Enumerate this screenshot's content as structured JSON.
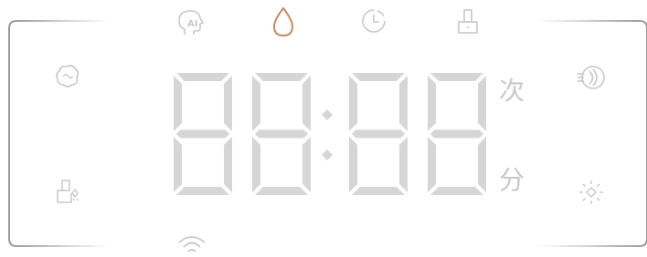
{
  "colors": {
    "inactive": "#c8c8c8",
    "segment": "#d6d6d6",
    "active_accent": "#c98a5c",
    "frame": "#9a9a9a"
  },
  "top_icons": [
    {
      "name": "ai-head-icon",
      "label": "AI",
      "active": false
    },
    {
      "name": "water-drop-icon",
      "active": true
    },
    {
      "name": "clock-timer-icon",
      "active": false
    },
    {
      "name": "faucet-icon",
      "active": false
    }
  ],
  "left_icons": [
    {
      "name": "stain-icon",
      "active": false
    },
    {
      "name": "self-clean-icon",
      "active": false
    }
  ],
  "right_icons": [
    {
      "name": "deodorize-icon",
      "active": false
    },
    {
      "name": "light-icon",
      "active": false
    }
  ],
  "bottom_icons": [
    {
      "name": "wifi-icon",
      "active": false
    }
  ],
  "display": {
    "digits": "88:88",
    "unit_top": "次",
    "unit_bottom": "分"
  }
}
